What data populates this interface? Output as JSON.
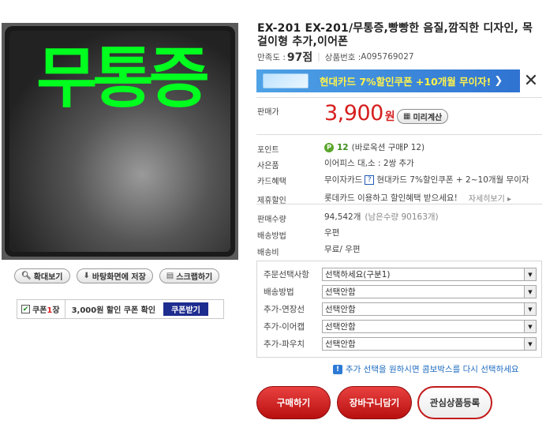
{
  "product": {
    "image_text": "무통증",
    "title": "EX-201 EX-201/무통증,빵빵한 음질,깜직한 디자인, 목걸이형 추가,이어폰",
    "satisfaction_label": "만족도 :",
    "satisfaction_score": "97점",
    "product_no_label": "상품번호 :",
    "product_no": "A095769027"
  },
  "image_buttons": {
    "zoom": "확대보기",
    "wallpaper": "바탕화면에 저장",
    "scrap": "스크랩하기"
  },
  "coupon": {
    "count_prefix": "쿠폰",
    "count_num": "1",
    "count_suffix": "장",
    "desc": "3,000원 할인 쿠폰 확인",
    "button": "쿠폰받기"
  },
  "banner": {
    "text": "현대카드 7%할인쿠폰 +10개월 무이자!",
    "arrow": "❯",
    "close": "✕"
  },
  "price": {
    "label": "판매가",
    "amount": "3,900",
    "unit": "원",
    "calc_button": "미리계산"
  },
  "info": {
    "point_label": "포인트",
    "point_num": "12",
    "point_text": "(바로옥션 구매P 12)",
    "gift_label": "사은품",
    "gift_value": "이어피스 대,소 : 2쌍 추가",
    "card_label": "카드혜택",
    "card_value_1": "무이자카드",
    "card_value_2": "현대카드 7%할인쿠폰 + 2~10개월 무이자",
    "discount_label": "제휴할인",
    "discount_value": "롯데카드 이용하고 할인혜택 받으세요!",
    "discount_more": "자세히보기 ▸",
    "sold_label": "판매수량",
    "sold_value": "94,542개",
    "sold_remaining": "(남은수량 90163개)",
    "ship_method_label": "배송방법",
    "ship_method_value": "우편",
    "ship_fee_label": "배송비",
    "ship_fee_value": "무료/ 우편"
  },
  "options": [
    {
      "label": "주문선택사항",
      "value": "선택하세요(구분1)"
    },
    {
      "label": "배송방법",
      "value": "선택안함"
    },
    {
      "label": "추가-연장선",
      "value": "선택안함"
    },
    {
      "label": "추가-이어캡",
      "value": "선택안함"
    },
    {
      "label": "추가-파우치",
      "value": "선택안함"
    }
  ],
  "notice": "추가 선택을 원하시면 콤보박스를 다시 선택하세요",
  "actions": {
    "buy": "구매하기",
    "cart": "장바구니담기",
    "wish": "관심상품등록"
  },
  "colors": {
    "price_red": "#d61e1e",
    "image_text_green": "#00ff1e",
    "coupon_btn": "#1d2c8f",
    "banner_blue": "#3d8ad9"
  }
}
